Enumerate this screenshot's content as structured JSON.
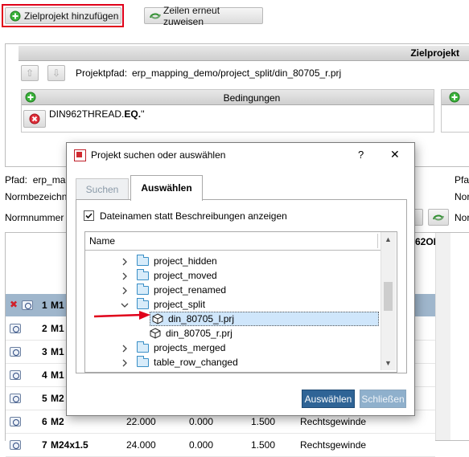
{
  "toolbar": {
    "add_target_label": "Zielprojekt hinzufügen",
    "reassign_label": "Zeilen erneut zuweisen"
  },
  "target_panel": {
    "header": "Zielprojekt",
    "path_label": "Projektpfad:",
    "path_value": "erp_mapping_demo/project_split/din_80705_r.prj",
    "conditions_header": "Bedingungen",
    "condition_prefix": "DIN962THREAD.",
    "condition_op": "EQ.",
    "condition_suffix": "''"
  },
  "left_fields": {
    "pfad_label": "Pfad:",
    "pfad_value": "erp_ma",
    "normbez_label": "Normbezeichn",
    "normnummer_label": "Normnummer"
  },
  "right_fields": {
    "pfad_label": "Pfa",
    "norm1_label": "Nor",
    "norm2_label": "Nor"
  },
  "table": {
    "partial_header": "62OI",
    "rows": [
      {
        "num": "1",
        "name": "M1"
      },
      {
        "num": "2",
        "name": "M1"
      },
      {
        "num": "3",
        "name": "M1"
      },
      {
        "num": "4",
        "name": "M1"
      },
      {
        "num": "5",
        "name": "M2"
      },
      {
        "num": "6",
        "name": "M2",
        "c1": "22.000",
        "c2": "0.000",
        "c3": "1.500",
        "c4": "Rechtsgewinde"
      },
      {
        "num": "7",
        "name": "M24x1.5",
        "c1": "24.000",
        "c2": "0.000",
        "c3": "1.500",
        "c4": "Rechtsgewinde"
      }
    ]
  },
  "dialog": {
    "title": "Projekt suchen oder auswählen",
    "help": "?",
    "close": "✕",
    "tab_search": "Suchen",
    "tab_select": "Auswählen",
    "checkbox_label": "Dateinamen statt Beschreibungen anzeigen",
    "checkbox_checked": true,
    "tree_header": "Name",
    "tree": [
      {
        "label": "project_hidden",
        "kind": "folder",
        "expanded": false
      },
      {
        "label": "project_moved",
        "kind": "folder",
        "expanded": false
      },
      {
        "label": "project_renamed",
        "kind": "folder",
        "expanded": false
      },
      {
        "label": "project_split",
        "kind": "folder",
        "expanded": true
      },
      {
        "label": "din_80705_l.prj",
        "kind": "project",
        "selected": true
      },
      {
        "label": "din_80705_r.prj",
        "kind": "project",
        "selected": false
      },
      {
        "label": "projects_merged",
        "kind": "folder",
        "expanded": false
      },
      {
        "label": "table_row_changed",
        "kind": "folder",
        "expanded": false
      }
    ],
    "ok_label": "Auswählen",
    "close_label": "Schließen"
  },
  "colors": {
    "highlight_red": "#e0001a",
    "selection_bg": "#cfe6fb",
    "primary_button": "#2f6496",
    "row_selected": "#9fb6cc"
  }
}
